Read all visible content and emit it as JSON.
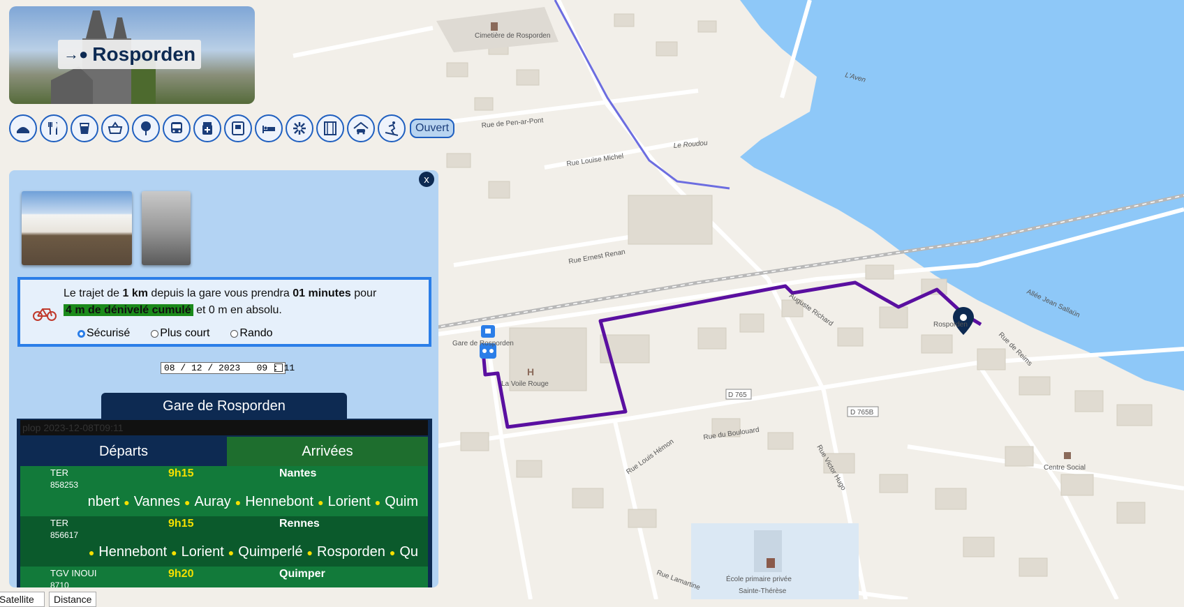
{
  "header": {
    "title": "Rosporden",
    "icon": "arrow-dot-icon"
  },
  "toolbar": {
    "buttons": [
      {
        "name": "bakery-icon"
      },
      {
        "name": "restaurant-icon"
      },
      {
        "name": "bar-icon"
      },
      {
        "name": "shop-basket-icon"
      },
      {
        "name": "park-tree-icon"
      },
      {
        "name": "bus-icon"
      },
      {
        "name": "pharmacy-icon"
      },
      {
        "name": "vending-icon"
      },
      {
        "name": "hotel-bed-icon"
      },
      {
        "name": "attraction-icon"
      },
      {
        "name": "cinema-icon"
      },
      {
        "name": "car-service-icon"
      },
      {
        "name": "ski-icon"
      }
    ],
    "open_label": "Ouvert"
  },
  "panel": {
    "close_label": "x",
    "trip": {
      "p1": "Le trajet de ",
      "distance": "1 km",
      "p2": " depuis la gare vous prendra ",
      "duration": "01 minutes",
      "p3": " pour",
      "elevation": "4 m de dénivelé cumulé",
      "p4": " et 0 m en absolu."
    },
    "modes": [
      {
        "label": "Sécurisé",
        "selected": true
      },
      {
        "label": "Plus court",
        "selected": false
      },
      {
        "label": "Rando",
        "selected": false
      }
    ],
    "datetime": "08 / 12 / 2023   09 : 11",
    "station_name": "Gare de Rosporden",
    "board": {
      "debug": "plop 2023-12-08T09:11",
      "tab_departures": "Départs",
      "tab_arrivals": "Arrivées",
      "rows": [
        {
          "type": "TER",
          "number": "858253",
          "time": "9h15",
          "destination": "Nantes",
          "stops": [
            "nbert",
            "Vannes",
            "Auray",
            "Hennebont",
            "Lorient",
            "Quim"
          ],
          "bg": "#127a3a"
        },
        {
          "type": "TER",
          "number": "856617",
          "time": "9h15",
          "destination": "Rennes",
          "stops": [
            "",
            "Hennebont",
            "Lorient",
            "Quimperlé",
            "Rosporden",
            "Qu"
          ],
          "bg": "#0b5a2c"
        },
        {
          "type": "TGV INOUI",
          "number": "8710",
          "time": "9h20",
          "destination": "Quimper",
          "stops": [],
          "bg": "#127a3a"
        }
      ]
    }
  },
  "map": {
    "labels": {
      "cemetery": "Cimetière de Rosporden",
      "roudou": "Le Roudou",
      "station": "Gare de Rosporden",
      "voile": "La Voile Rouge",
      "town": "Rosporden",
      "centre": "Centre Social",
      "ecole1": "École primaire privée",
      "ecole2": "Sainte-Thérèse",
      "d765": "D 765",
      "d765b": "D 765B",
      "rue_penarpont": "Rue de Pen-ar-Pont",
      "rue_louise": "Rue Louise Michel",
      "rue_ernest": "Rue Ernest Renan",
      "rue_boulouard": "Rue du Boulouard",
      "rue_louis": "Rue Louis Hémon",
      "rue_victor": "Rue Victor Hugo",
      "rue_lamartine": "Rue Lamartine",
      "allee_jean": "Allée Jean Sallaün",
      "rue_reims": "Rue de Reims",
      "auguste": "Auguste Richard",
      "aven": "L'Aven"
    },
    "colors": {
      "water": "#8ec8f8",
      "route": "#5a0fa0",
      "land": "#f2efe9",
      "building": "#e0dbd1"
    }
  },
  "bottom": {
    "satellite": "Satellite",
    "distance": "Distance"
  }
}
